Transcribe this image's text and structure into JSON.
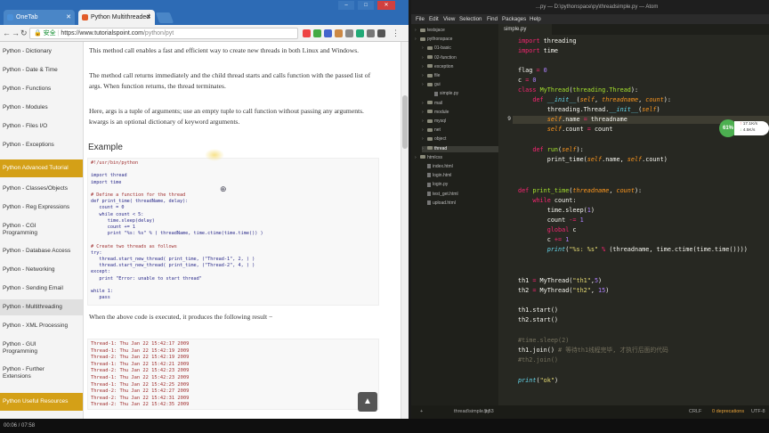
{
  "browser": {
    "tabs": [
      {
        "label": "OneTab"
      },
      {
        "label": "Python Multithreaded"
      }
    ],
    "address": {
      "secure_label": "安全",
      "host": "https://www.tutorialspoint.com",
      "path": "/python/pyt"
    },
    "sidebar": [
      {
        "label": "Python - Dictionary"
      },
      {
        "label": "Python - Date & Time"
      },
      {
        "label": "Python - Functions"
      },
      {
        "label": "Python - Modules"
      },
      {
        "label": "Python - Files I/O"
      },
      {
        "label": "Python - Exceptions"
      },
      {
        "label": "Python Advanced Tutorial"
      },
      {
        "label": "Python - Classes/Objects"
      },
      {
        "label": "Python - Reg Expressions"
      },
      {
        "label": "Python - CGI Programming"
      },
      {
        "label": "Python - Database Access"
      },
      {
        "label": "Python - Networking"
      },
      {
        "label": "Python - Sending Email"
      },
      {
        "label": "Python - Multithreading"
      },
      {
        "label": "Python - XML Processing"
      },
      {
        "label": "Python - GUI Programming"
      },
      {
        "label": "Python - Further Extensions"
      },
      {
        "label": "Python Useful Resources"
      }
    ],
    "content": {
      "p1": "This method call enables a fast and efficient way to create new threads in both Linux and Windows.",
      "p2": "The method call returns immediately and the child thread starts and calls function with the passed list of args. When function returns, the thread terminates.",
      "p3": "Here, args is a tuple of arguments; use an empty tuple to call function without passing any arguments. kwargs is an optional dictionary of keyword arguments.",
      "example_heading": "Example",
      "code_lines": [
        "#!/usr/bin/python",
        "",
        "import thread",
        "import time",
        "",
        "# Define a function for the thread",
        "def print_time( threadName, delay):",
        "   count = 0",
        "   while count < 5:",
        "      time.sleep(delay)",
        "      count += 1",
        "      print \"%s: %s\" % ( threadName, time.ctime(time.time()) )",
        "",
        "# Create two threads as follows",
        "try:",
        "   thread.start_new_thread( print_time, (\"Thread-1\", 2, ) )",
        "   thread.start_new_thread( print_time, (\"Thread-2\", 4, ) )",
        "except:",
        "   print \"Error: unable to start thread\"",
        "",
        "while 1:",
        "   pass"
      ],
      "result_text": "When the above code is executed, it produces the following result −",
      "output_lines": [
        "Thread-1: Thu Jan 22 15:42:17 2009",
        "Thread-1: Thu Jan 22 15:42:19 2009",
        "Thread-2: Thu Jan 22 15:42:19 2009",
        "Thread-1: Thu Jan 22 15:42:21 2009",
        "Thread-2: Thu Jan 22 15:42:23 2009",
        "Thread-1: Thu Jan 22 15:42:23 2009",
        "Thread-1: Thu Jan 22 15:42:25 2009",
        "Thread-2: Thu Jan 22 15:42:27 2009",
        "Thread-2: Thu Jan 22 15:42:31 2009",
        "Thread-2: Thu Jan 22 15:42:35 2009"
      ]
    }
  },
  "editor": {
    "title": "...py — D:\\pythonspace\\py\\threadsimple.py — Atom",
    "menu": [
      "File",
      "Edit",
      "View",
      "Selection",
      "Find",
      "Packages",
      "Help"
    ],
    "tree": [
      {
        "label": "testsjace",
        "kind": "folder",
        "level": 0
      },
      {
        "label": "pythonspace",
        "kind": "folder",
        "level": 0
      },
      {
        "label": "01-basic",
        "kind": "folder",
        "level": 1
      },
      {
        "label": "02-function",
        "kind": "folder",
        "level": 1
      },
      {
        "label": "exception",
        "kind": "folder",
        "level": 1
      },
      {
        "label": "file",
        "kind": "folder",
        "level": 1
      },
      {
        "label": "gui",
        "kind": "folder",
        "level": 1
      },
      {
        "label": "simple.py",
        "kind": "file",
        "level": 2
      },
      {
        "label": "mail",
        "kind": "folder",
        "level": 1
      },
      {
        "label": "module",
        "kind": "folder",
        "level": 1
      },
      {
        "label": "mysql",
        "kind": "folder",
        "level": 1
      },
      {
        "label": "net",
        "kind": "folder",
        "level": 1
      },
      {
        "label": "object",
        "kind": "folder",
        "level": 1
      },
      {
        "label": "thread",
        "kind": "folder",
        "level": 1
      },
      {
        "label": "htmlcss",
        "kind": "folder",
        "level": 0
      },
      {
        "label": "index.html",
        "kind": "file",
        "level": 1
      },
      {
        "label": "login.html",
        "kind": "file",
        "level": 1
      },
      {
        "label": "login.py",
        "kind": "file",
        "level": 1
      },
      {
        "label": "test_get.html",
        "kind": "file",
        "level": 1
      },
      {
        "label": "upload.html",
        "kind": "file",
        "level": 1
      }
    ],
    "tab_label": "simple.py",
    "status": {
      "file": "thread\\simple.py",
      "pos": "9:53",
      "eol": "CRLF",
      "enc": "UTF-8",
      "issues": "0 deprecations"
    },
    "monitor": {
      "cpu": "61%",
      "up": "17.1K/s",
      "down": "4.5K/s"
    }
  },
  "taskbar": {
    "time": "00:06 / 07:58"
  }
}
